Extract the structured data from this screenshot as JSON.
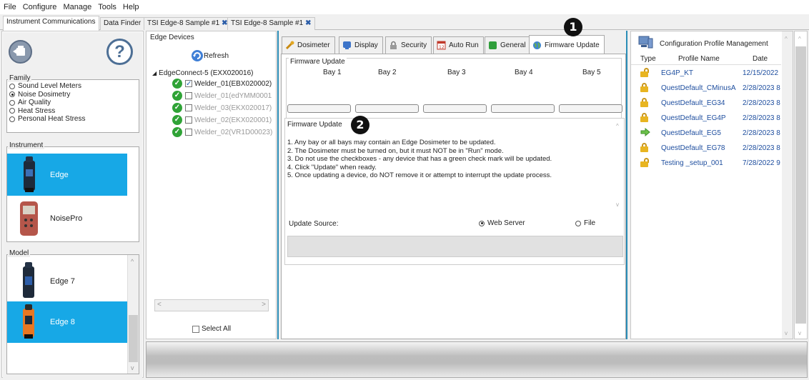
{
  "menu": [
    "File",
    "Configure",
    "Manage",
    "Tools",
    "Help"
  ],
  "doc_tabs": [
    {
      "label": "Instrument Communications",
      "closable": false,
      "active": true
    },
    {
      "label": "Data Finder",
      "closable": false,
      "active": false
    },
    {
      "label": "TSI Edge-8 Sample #1",
      "closable": true,
      "active": false
    },
    {
      "label": "TSI Edge-8 Sample #1",
      "closable": true,
      "active": false
    }
  ],
  "close_glyph": "✖",
  "left": {
    "family_label": "Family",
    "family_options": [
      "Sound Level Meters",
      "Noise Dosimetry",
      "Air Quality",
      "Heat Stress",
      "Personal Heat Stress"
    ],
    "family_selected": "Noise Dosimetry",
    "help_glyph": "?",
    "instrument_label": "Instrument",
    "instruments": [
      "Edge",
      "NoisePro"
    ],
    "model_label": "Model",
    "models": [
      "Edge 7",
      "Edge 8"
    ]
  },
  "edge_devices": {
    "title": "Edge Devices",
    "refresh_label": "Refresh",
    "root": "EdgeConnect-5 (EXX020016)",
    "devices": [
      {
        "name": "Welder_01(EBX020002)",
        "checked": true,
        "enabled": true
      },
      {
        "name": "Welder_01(edYMM0001",
        "checked": false,
        "enabled": false
      },
      {
        "name": "Welder_03(EKX020017)",
        "checked": false,
        "enabled": false
      },
      {
        "name": "Welder_02(EKX020001)",
        "checked": false,
        "enabled": false
      },
      {
        "name": "Welder_02(VR1D00023)",
        "checked": false,
        "enabled": false
      }
    ],
    "select_all_label": "Select All"
  },
  "tabs": [
    "Dosimeter",
    "Display",
    "Security",
    "Auto Run",
    "General",
    "Firmware Update"
  ],
  "active_tab": "Firmware Update",
  "firmware": {
    "group_title": "Firmware Update",
    "bays": [
      "Bay 1",
      "Bay 2",
      "Bay 3",
      "Bay 4",
      "Bay 5"
    ],
    "instructions_title": "Firmware Update",
    "instructions": [
      "1. Any bay or all bays may contain an Edge Dosimeter to be updated.",
      "2. The Dosimeter must be turned on, but it must NOT be in \"Run\" mode.",
      "3. Do not use the checkboxes - any device that has a green check mark will be updated.",
      "4. Click \"Update\" when ready.",
      "5. Once updating a device, do NOT remove it or attempt to interrupt the update process."
    ],
    "update_source_label": "Update Source:",
    "source_web": "Web Server",
    "source_file": "File",
    "source_selected": "Web Server"
  },
  "profiles": {
    "title": "Configuration Profile Management",
    "columns": [
      "Type",
      "Profile Name",
      "Date"
    ],
    "rows": [
      {
        "type": "unlocked",
        "name": "EG4P_KT",
        "date": "12/15/2022"
      },
      {
        "type": "locked",
        "name": "QuestDefault_CMinusA",
        "date": "2/28/2023 8"
      },
      {
        "type": "locked",
        "name": "QuestDefault_EG34",
        "date": "2/28/2023 8"
      },
      {
        "type": "locked",
        "name": "QuestDefault_EG4P",
        "date": "2/28/2023 8"
      },
      {
        "type": "arrow",
        "name": "QuestDefault_EG5",
        "date": "2/28/2023 8"
      },
      {
        "type": "locked",
        "name": "QuestDefault_EG78",
        "date": "2/28/2023 8"
      },
      {
        "type": "unlocked",
        "name": "Testing _setup_001",
        "date": "7/28/2022 9"
      }
    ]
  },
  "callouts": [
    "1",
    "2"
  ],
  "colors": {
    "accent": "#17a8e6",
    "link": "#1d4d9e",
    "ok": "#2fa336",
    "border_accent": "#2a8db7"
  }
}
